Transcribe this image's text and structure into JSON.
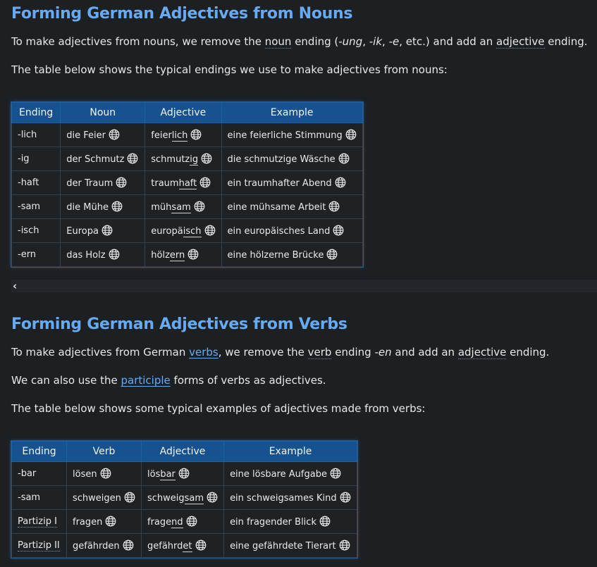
{
  "nouns_section": {
    "title": "Forming German Adjectives from Nouns",
    "intro": {
      "t1": "To make adjectives from nouns, we remove the ",
      "noun": "noun",
      "t2": " ending (",
      "e1": "-ung",
      "sep1": ", ",
      "e2": "-ik",
      "sep2": ", ",
      "e3": "-e",
      "t3": ", etc.) and add an ",
      "adjective": "adjective",
      "t4": " ending."
    },
    "table_intro": "The table below shows the typical endings we use to make adjectives from nouns:",
    "headers": [
      "Ending",
      "Noun",
      "Adjective",
      "Example"
    ],
    "rows": [
      {
        "ending": "-lich",
        "noun": "die Feier",
        "adj_stem": "feier",
        "adj_suffix": "lich",
        "adj_rest": "",
        "example": "eine feierliche Stimmung"
      },
      {
        "ending": "-ig",
        "noun": "der Schmutz",
        "adj_stem": "schmutz",
        "adj_suffix": "ig",
        "adj_rest": "",
        "example": "die schmutzige Wäsche"
      },
      {
        "ending": "-haft",
        "noun": "der Traum",
        "adj_stem": "traum",
        "adj_suffix": "haft",
        "adj_rest": "",
        "example": "ein traumhafter Abend"
      },
      {
        "ending": "-sam",
        "noun": "die Mühe",
        "adj_stem": "müh",
        "adj_suffix": "sam",
        "adj_rest": "",
        "example": "eine mühsame Arbeit"
      },
      {
        "ending": "-isch",
        "noun": "Europa",
        "adj_stem": "europä",
        "adj_suffix": "isch",
        "adj_rest": "",
        "example": "ein europäisches Land"
      },
      {
        "ending": "-ern",
        "noun": "das Holz",
        "adj_stem": "hölz",
        "adj_suffix": "ern",
        "adj_rest": "",
        "example": "eine hölzerne Brücke"
      }
    ]
  },
  "scrollbar": {
    "left_arrow": "‹"
  },
  "verbs_section": {
    "title": "Forming German Adjectives from Verbs",
    "intro": {
      "t1": "To make adjectives from German ",
      "verbs_link": "verbs",
      "t2": ", we remove the ",
      "verb": "verb",
      "t3": " ending ",
      "en": "-en",
      "t4": " and add an ",
      "adjective": "adjective",
      "t5": " ending."
    },
    "participle_line": {
      "t1": "We can also use the ",
      "link": "participle",
      "t2": " forms of verbs as adjectives."
    },
    "table_intro": "The table below shows some typical examples of adjectives made from verbs:",
    "headers": [
      "Ending",
      "Verb",
      "Adjective",
      "Example"
    ],
    "rows": [
      {
        "ending": "-bar",
        "ending_link": false,
        "verb": "lösen",
        "adj_stem": "lös",
        "adj_suffix": "bar",
        "adj_rest": "",
        "example": "eine lösbare Aufgabe"
      },
      {
        "ending": "-sam",
        "ending_link": false,
        "verb": "schweigen",
        "adj_stem": "schweig",
        "adj_suffix": "sam",
        "adj_rest": "",
        "example": "ein schweigsames Kind"
      },
      {
        "ending": "Partizip I",
        "ending_link": true,
        "verb": "fragen",
        "adj_stem": "frage",
        "adj_suffix": "nd",
        "adj_rest": "",
        "example": "ein fragender Blick"
      },
      {
        "ending": "Partizip II",
        "ending_link": true,
        "verb": "gefährden",
        "adj_stem": "gefährd",
        "adj_suffix": "et",
        "adj_rest": "",
        "example": "eine gefährdete Tierart"
      }
    ]
  },
  "icons": {
    "audio": "globe-icon"
  },
  "colors": {
    "background": "#1d2023",
    "heading": "#67aaf2",
    "table_header": "#15528f",
    "link": "#67aaf2"
  }
}
